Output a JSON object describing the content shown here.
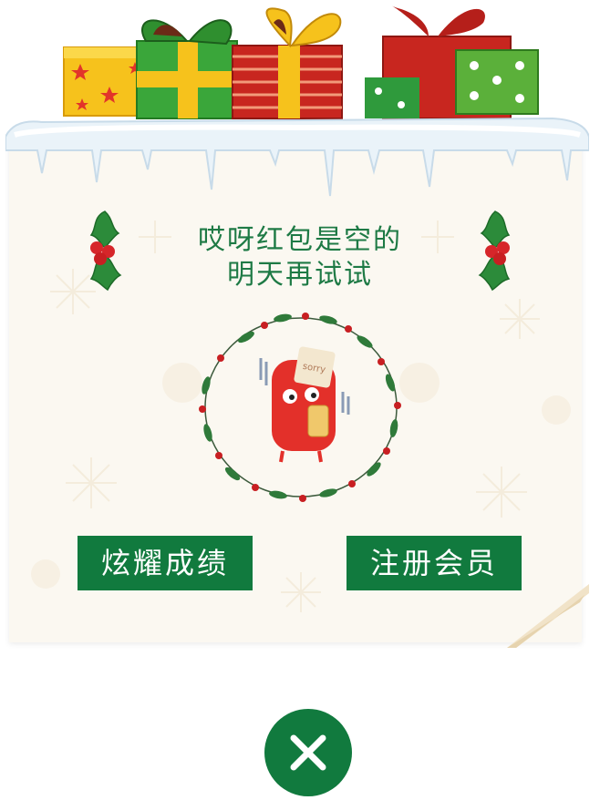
{
  "dialog": {
    "title_line1": "哎呀红包是空的",
    "title_line2": "明天再试试",
    "mascot_sign": "sorry"
  },
  "buttons": {
    "show_off_label": "炫耀成绩",
    "register_label": "注册会员"
  },
  "icons": {
    "close": "close-icon",
    "gifts": "gift-boxes-icon",
    "holly": "holly-icon",
    "wreath": "wreath-icon",
    "mascot": "red-envelope-mascot-icon"
  },
  "colors": {
    "primary_green": "#117a3e",
    "title_green": "#1e7a45",
    "card_bg": "#fbf8f1",
    "accent_red": "#d6262a"
  }
}
